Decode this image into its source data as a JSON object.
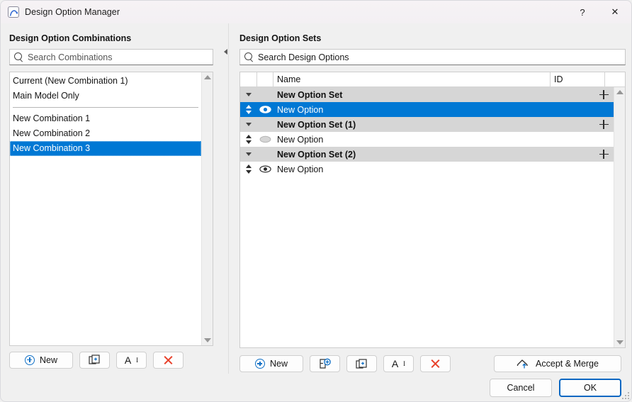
{
  "window": {
    "title": "Design Option Manager",
    "app_icon": "arc-curve-icon",
    "help_label": "?",
    "close_label": "✕"
  },
  "left_panel": {
    "heading": "Design Option Combinations",
    "search": {
      "placeholder": "Search Combinations",
      "value": "",
      "icon": "search-icon"
    },
    "items": [
      {
        "label": "Current (New Combination 1)",
        "selected": false,
        "separator_after": false
      },
      {
        "label": "Main Model Only",
        "selected": false,
        "separator_after": true
      },
      {
        "label": "New Combination 1",
        "selected": false,
        "separator_after": false
      },
      {
        "label": "New Combination 2",
        "selected": false,
        "separator_after": false
      },
      {
        "label": "New Combination 3",
        "selected": true,
        "separator_after": false
      }
    ],
    "scrollbar": {
      "up": "scroll-up-arrow",
      "down": "scroll-down-arrow"
    },
    "toolbar": {
      "new_label": "New",
      "duplicate_label": "",
      "rename_label": "A",
      "rename_sup": "I",
      "delete_label": ""
    }
  },
  "splitter": {
    "collapse_icon": "chevron-left-icon"
  },
  "right_panel": {
    "heading": "Design Option Sets",
    "search": {
      "placeholder": "Search Design Options",
      "value": "",
      "icon": "search-icon"
    },
    "columns": [
      {
        "key": "reorder",
        "label": ""
      },
      {
        "key": "visibility",
        "label": ""
      },
      {
        "key": "name",
        "label": "Name"
      },
      {
        "key": "id",
        "label": "ID"
      },
      {
        "key": "action",
        "label": ""
      }
    ],
    "rows": [
      {
        "type": "set",
        "name": "New Option Set",
        "id": "",
        "expanded": true,
        "add_icon": "plus-icon",
        "selected": false
      },
      {
        "type": "option",
        "name": "New Option",
        "id": "",
        "visible": true,
        "selected": true
      },
      {
        "type": "set",
        "name": "New Option Set (1)",
        "id": "",
        "expanded": true,
        "add_icon": "plus-icon",
        "selected": false
      },
      {
        "type": "option",
        "name": "New Option",
        "id": "",
        "visible": false,
        "selected": false
      },
      {
        "type": "set",
        "name": "New Option Set (2)",
        "id": "",
        "expanded": true,
        "add_icon": "plus-icon",
        "selected": false
      },
      {
        "type": "option",
        "name": "New Option",
        "id": "",
        "visible": true,
        "selected": false
      }
    ],
    "scrollbar": {
      "up": "scroll-up-arrow",
      "down": "scroll-down-arrow"
    },
    "toolbar": {
      "new_label": "New",
      "new_set_label": "",
      "duplicate_label": "",
      "rename_label": "A",
      "rename_sup": "I",
      "delete_label": "",
      "accept_merge_label": "Accept & Merge"
    }
  },
  "footer": {
    "cancel_label": "Cancel",
    "ok_label": "OK"
  },
  "colors": {
    "accent": "#0078d4",
    "group_row": "#d6d6d6",
    "blue_icon": "#1070c6",
    "red_icon": "#e8402a",
    "window_bg": "#f0f0f0"
  }
}
